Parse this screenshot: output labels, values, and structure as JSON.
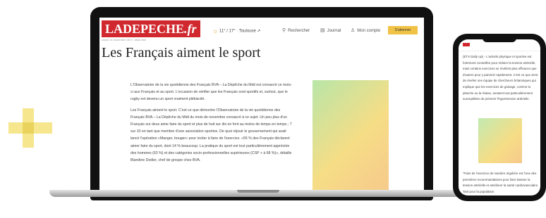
{
  "site": {
    "logo_main": "LADEPECHE",
    "logo_suffix": ".fr",
    "dateline": "mardi 14 novembre 2017, Midi-Midi"
  },
  "header": {
    "weather": "11° / 17° · Toulouse",
    "weather_icon": "sun-cloud-icon",
    "nav": [
      {
        "label": "Rechercher",
        "icon": "search-icon"
      },
      {
        "label": "Journal",
        "icon": "newspaper-icon"
      },
      {
        "label": "Mon compte",
        "icon": "user-icon"
      }
    ],
    "subscribe_label": "S'abonner"
  },
  "article": {
    "title": "Les Français aiment le sport",
    "paragraphs": [
      "L'Observatoire de la vie quotidienne des Français BVA – La Dépêche du Midi est consacré ce mois-ci aux Français et au sport. L'occasion de vérifier que les Français sont sportifs et, surtout, que le rugby est devenu un sport vraiment plébiscité.",
      "Les Français aiment le sport. C'est ce que démontre l'Observatoire de la vie quotidienne des Français BVA – La Dépêche du Midi du mois de novembre consacré à ce sujet. Un peu plus d'un Français sur deux aime faire du sport et plus de huit sur dix en font au moins de temps en temps ; 7 sur 10 en tant que membre d'une association sportive. De quoi réjouir le gouvernement qui avait lancé l'opération «Manger, bouger» pour inciter à faire de l'exercice. «55 % des Français déclarent aimer faire du sport, dont 14 % beaucoup. La pratique du sport est tout particulièrement appréciée des hommes (63 %) et des catégories socio-professionnelles supérieures (CSP + à 68 %)», détaille Blandine Dodier, chef de groupe chez BVA."
    ]
  },
  "phone": {
    "text_top": "(ETX Daily Up) - L'activité physique et sportive est fortement conseillée pour réduire la tension artérielle, mais certains exercices se révèlent plus efficaces que d'autres pour y parvenir rapidement. C'est ce que vient de révéler une équipe de chercheurs britanniques qui explique que les exercices de gainage, comme la planche ou la chaise, seraient tout particulièrement susceptibles de prévenir l'hypertension artérielle.",
    "text_bottom": "\"Faire de l'exercice de manière régulière est l'une des premières recommandations pour faire baisser la tension artérielle et améliorer la santé cardiovasculaire. Tant pour la population"
  },
  "colors": {
    "brand_red": "#d0282e",
    "subscribe_yellow": "#f0c245",
    "decor_yellow": "#f4e27a"
  }
}
